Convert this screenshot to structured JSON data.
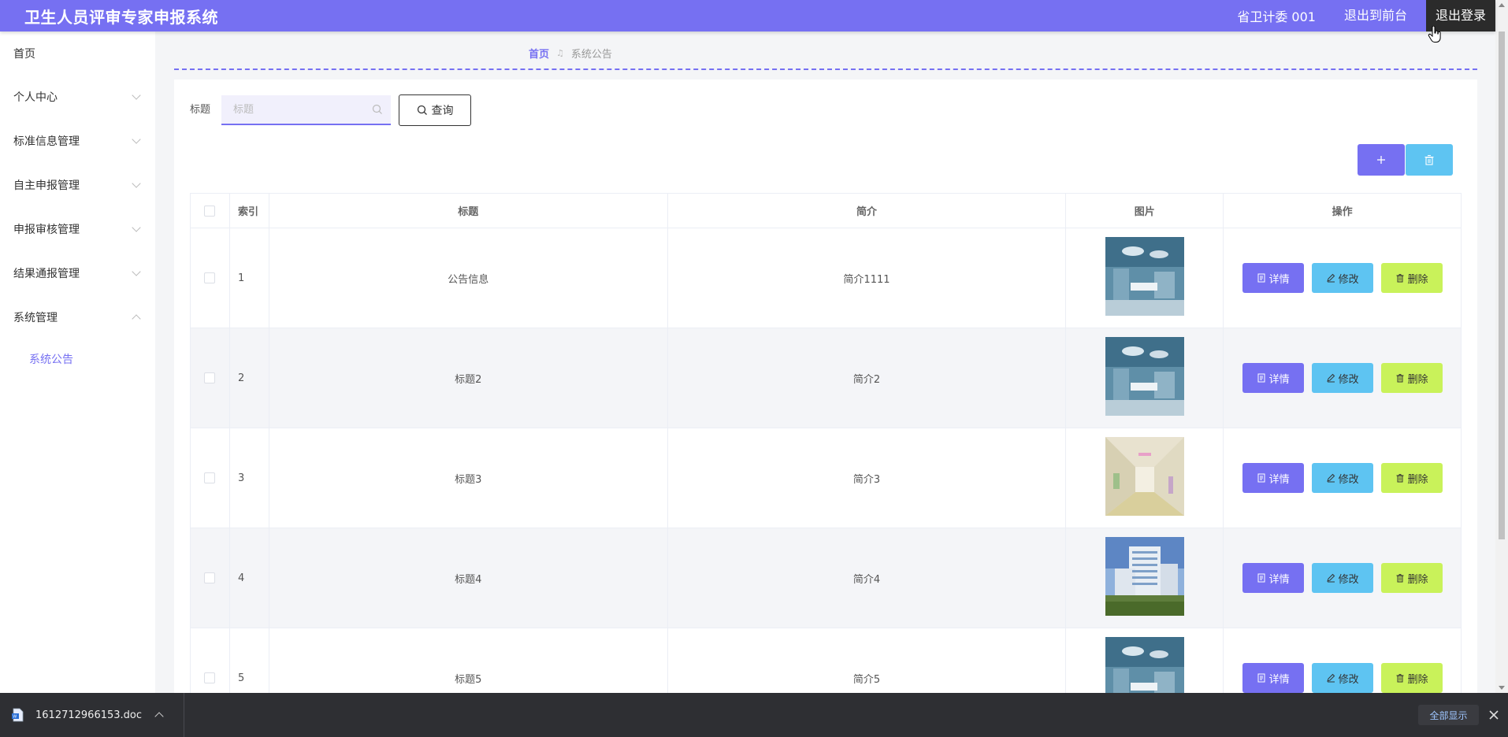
{
  "header": {
    "title": "卫生人员评审专家申报系统",
    "user": "省卫计委 001",
    "front_link": "退出到前台",
    "logout": "退出登录"
  },
  "sidebar": {
    "items": [
      {
        "label": "首页"
      },
      {
        "label": "个人中心"
      },
      {
        "label": "标准信息管理"
      },
      {
        "label": "自主申报管理"
      },
      {
        "label": "申报审核管理"
      },
      {
        "label": "结果通报管理"
      },
      {
        "label": "系统管理"
      }
    ],
    "sub_items": [
      {
        "label": "系统公告"
      }
    ]
  },
  "breadcrumb": {
    "home": "首页",
    "current": "系统公告"
  },
  "search": {
    "label": "标题",
    "placeholder": "标题",
    "value": "",
    "button": "查询"
  },
  "table": {
    "headers": {
      "index": "索引",
      "title": "标题",
      "desc": "简介",
      "image": "图片",
      "ops": "操作"
    },
    "op_labels": {
      "detail": "详情",
      "edit": "修改",
      "delete": "删除"
    },
    "rows": [
      {
        "index": "1",
        "title": "公告信息",
        "desc": "简介1111",
        "image": "operating-room"
      },
      {
        "index": "2",
        "title": "标题2",
        "desc": "简介2",
        "image": "operating-room"
      },
      {
        "index": "3",
        "title": "标题3",
        "desc": "简介3",
        "image": "hospital-corridor"
      },
      {
        "index": "4",
        "title": "标题4",
        "desc": "简介4",
        "image": "hospital-building"
      },
      {
        "index": "5",
        "title": "标题5",
        "desc": "简介5",
        "image": "operating-room"
      }
    ]
  },
  "download_bar": {
    "filename": "1612712966153.doc",
    "show_all": "全部显示"
  },
  "colors": {
    "accent": "#7670f2",
    "info": "#5ec4f2",
    "warning": "#c9f25a"
  }
}
